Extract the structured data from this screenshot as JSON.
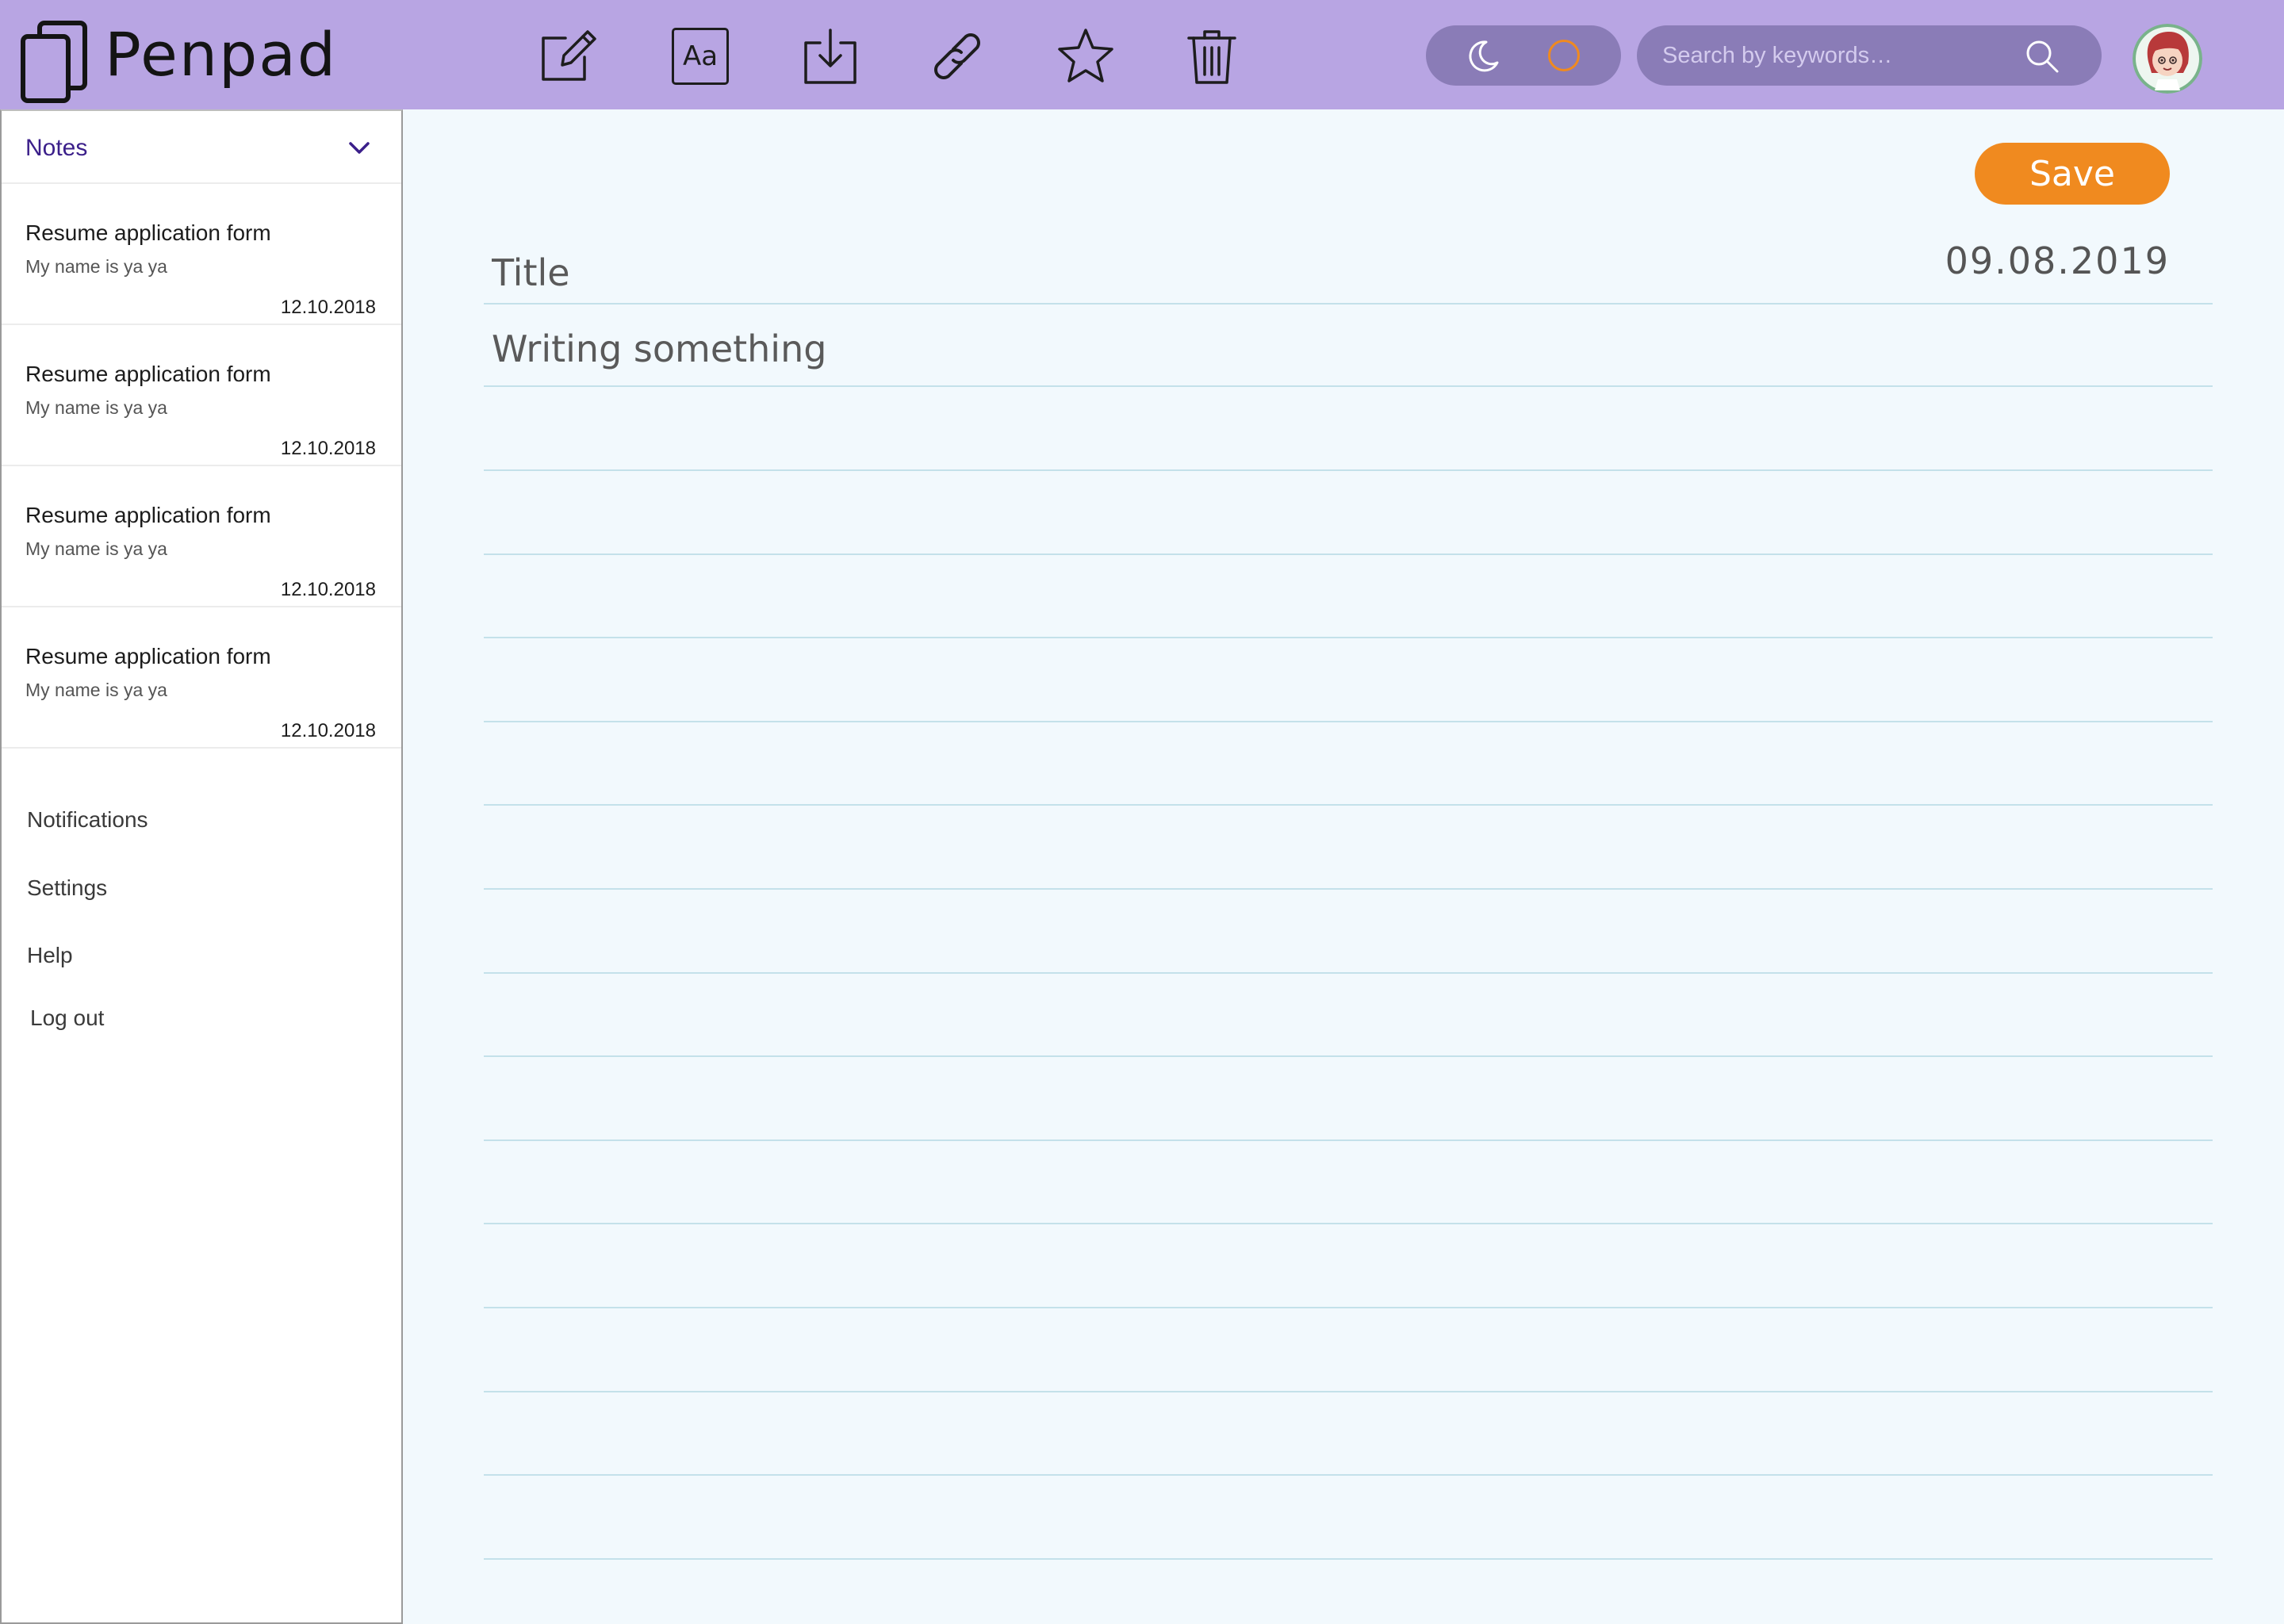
{
  "app": {
    "name": "Penpad"
  },
  "toolbar": {
    "tools": [
      {
        "name": "edit-icon"
      },
      {
        "name": "font-icon",
        "label": "Aa"
      },
      {
        "name": "download-icon"
      },
      {
        "name": "link-icon"
      },
      {
        "name": "star-icon"
      },
      {
        "name": "trash-icon"
      }
    ],
    "theme_toggle": {
      "icons": [
        "moon-icon",
        "sun-icon"
      ],
      "accent": "#f08a1f"
    },
    "search": {
      "placeholder": "Search by keywords…",
      "value": ""
    }
  },
  "sidebar": {
    "section_label": "Notes",
    "notes": [
      {
        "title": "Resume application form",
        "preview": "My name is ya ya",
        "date": "12.10.2018"
      },
      {
        "title": "Resume application form",
        "preview": "My name is ya ya",
        "date": "12.10.2018"
      },
      {
        "title": "Resume application form",
        "preview": "My name is ya ya",
        "date": "12.10.2018"
      },
      {
        "title": "Resume application form",
        "preview": "My name is ya ya",
        "date": "12.10.2018"
      }
    ],
    "nav": [
      {
        "label": "Notifications"
      },
      {
        "label": "Settings"
      },
      {
        "label": "Help"
      },
      {
        "label": "Log out"
      }
    ]
  },
  "editor": {
    "save_label": "Save",
    "title_placeholder": "Title",
    "title_value": "",
    "date": "09.08.2019",
    "body_placeholder": "Writing something",
    "body_value": ""
  },
  "colors": {
    "topbar": "#b8a5e3",
    "pill": "#8a7cb7",
    "accent": "#f08a1f",
    "editor_bg": "#f2f9fd",
    "rule": "#c4e1ea",
    "notes_header": "#3b1f8a"
  }
}
